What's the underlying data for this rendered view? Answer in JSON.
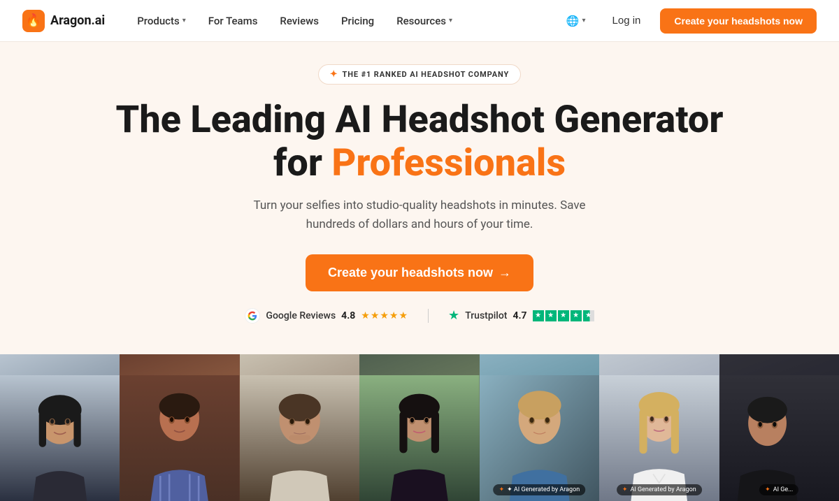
{
  "nav": {
    "logo_text": "Aragon.ai",
    "links": [
      {
        "label": "Products",
        "has_dropdown": true
      },
      {
        "label": "For Teams",
        "has_dropdown": false
      },
      {
        "label": "Reviews",
        "has_dropdown": false
      },
      {
        "label": "Pricing",
        "has_dropdown": false
      },
      {
        "label": "Resources",
        "has_dropdown": true
      }
    ],
    "login_label": "Log in",
    "cta_label": "Create your headshots now",
    "globe_label": "🌐"
  },
  "hero": {
    "badge_icon": "✦",
    "badge_text": "THE #1 RANKED AI HEADSHOT COMPANY",
    "title_line1": "The Leading AI Headshot Generator",
    "title_line2_plain": "for ",
    "title_line2_accent": "Professionals",
    "subtitle": "Turn your selfies into studio-quality headshots in minutes. Save hundreds of dollars and hours of your time.",
    "cta_label": "Create your headshots now",
    "cta_arrow": "→"
  },
  "reviews": {
    "google_label": "Google Reviews",
    "google_score": "4.8",
    "google_stars": "★★★★★",
    "trustpilot_label": "Trustpilot",
    "trustpilot_score": "4.7"
  },
  "photos": [
    {
      "id": 1,
      "ai_badge": "",
      "label": "Photo 1"
    },
    {
      "id": 2,
      "ai_badge": "",
      "label": "Photo 2"
    },
    {
      "id": 3,
      "ai_badge": "",
      "label": "Photo 3"
    },
    {
      "id": 4,
      "ai_badge": "",
      "label": "Photo 4"
    },
    {
      "id": 5,
      "ai_badge": "✦ AI Generated by Aragon",
      "label": "Photo 5"
    },
    {
      "id": 6,
      "ai_badge": "✦ AI Generated by Aragon",
      "label": "Photo 6"
    },
    {
      "id": 7,
      "ai_badge": "✦ AI Ge...",
      "label": "Photo 7"
    }
  ]
}
